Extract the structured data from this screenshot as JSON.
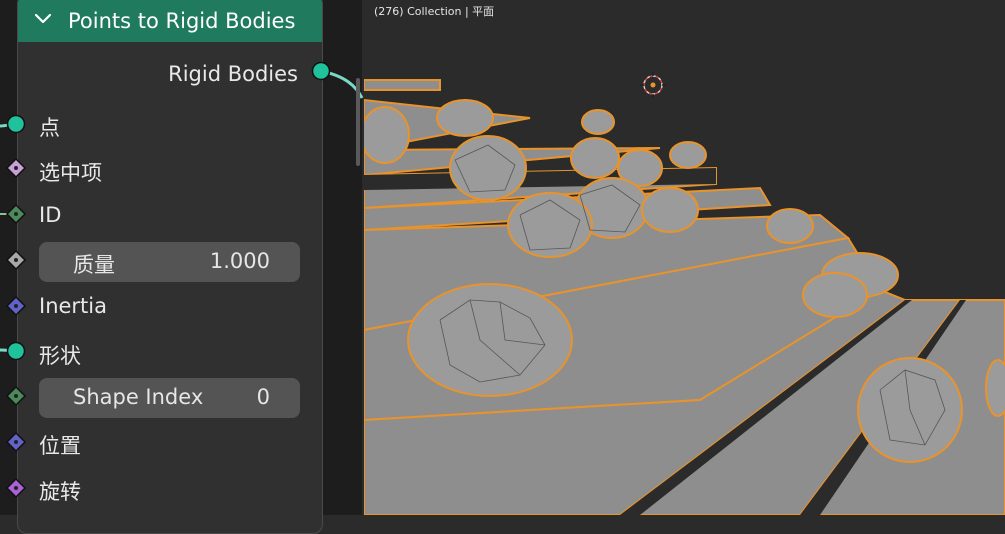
{
  "node": {
    "title": "Points to Rigid Bodies",
    "output_label": "Rigid Bodies",
    "inputs": {
      "points": "点",
      "selection": "选中项",
      "id": "ID",
      "inertia": "Inertia",
      "shape": "形状",
      "position": "位置",
      "rotation": "旋转"
    },
    "mass": {
      "label": "质量",
      "value": "1.000"
    },
    "shape_index": {
      "label": "Shape Index",
      "value": "0"
    }
  },
  "viewport": {
    "header_text": "(276) Collection | 平面",
    "selection_color": "#e8932b"
  },
  "colors": {
    "node_header": "#1f7a5e",
    "socket_geometry": "#1fc29b",
    "socket_boolean": "#c9a0d6",
    "socket_integer": "#4c8a5c",
    "socket_float": "#a8a8a8",
    "socket_vector": "#6262c8",
    "socket_rotation": "#a862d6"
  }
}
